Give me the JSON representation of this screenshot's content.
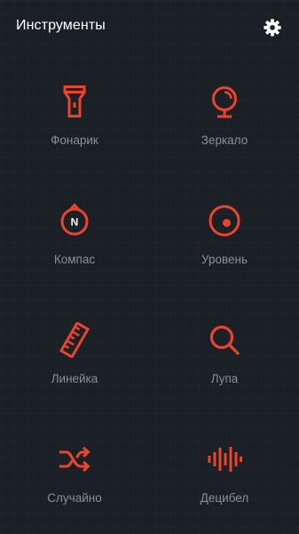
{
  "header": {
    "title": "Инструменты",
    "settings_icon": "gear-icon"
  },
  "accent_color": "#e8452c",
  "tools": [
    {
      "label": "Фонарик",
      "icon": "flashlight-icon"
    },
    {
      "label": "Зеркало",
      "icon": "mirror-icon"
    },
    {
      "label": "Компас",
      "icon": "compass-icon"
    },
    {
      "label": "Уровень",
      "icon": "level-icon"
    },
    {
      "label": "Линейка",
      "icon": "ruler-icon"
    },
    {
      "label": "Лупа",
      "icon": "magnifier-icon"
    },
    {
      "label": "Случайно",
      "icon": "shuffle-icon"
    },
    {
      "label": "Децибел",
      "icon": "decibel-icon"
    }
  ]
}
